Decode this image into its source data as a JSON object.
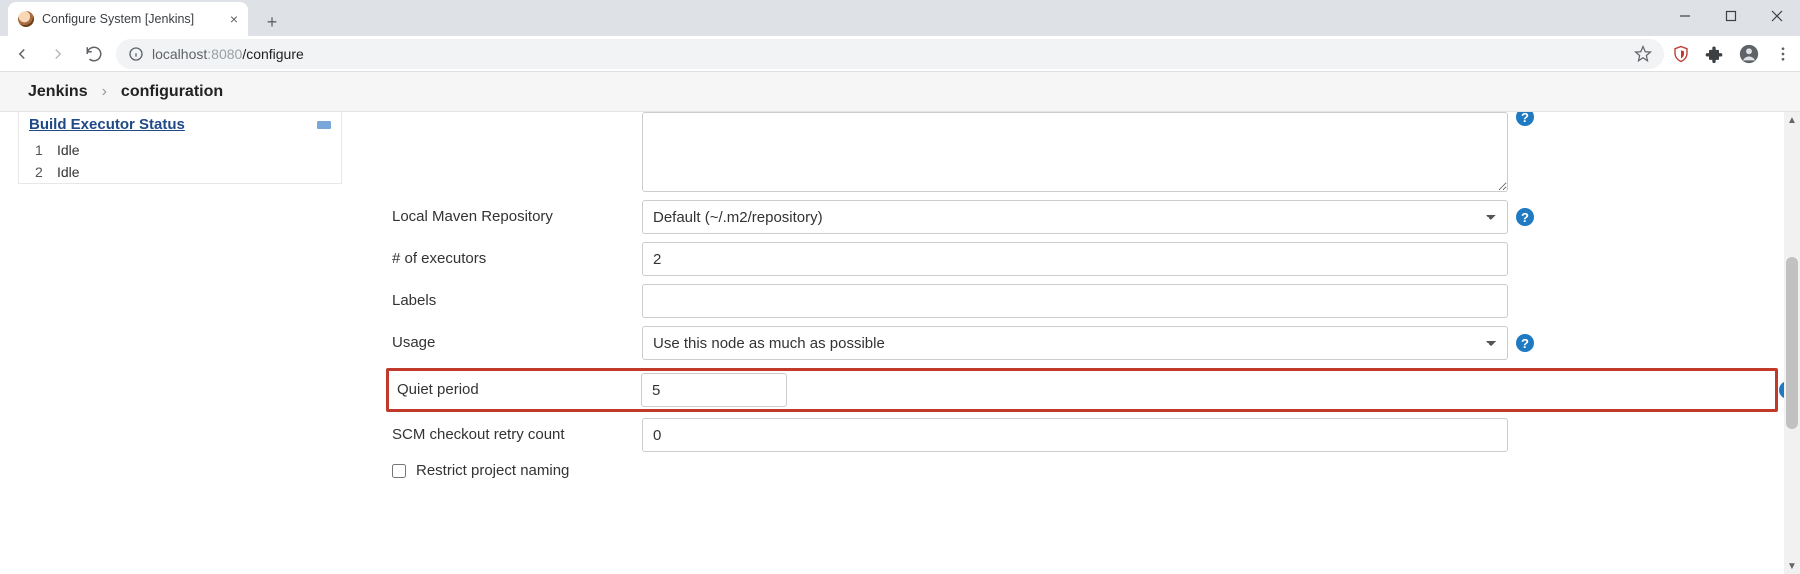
{
  "browser": {
    "tab_title": "Configure System [Jenkins]",
    "url_host": "localhost",
    "url_port": ":8080",
    "url_path": "/configure"
  },
  "breadcrumb": {
    "root": "Jenkins",
    "current": "configuration"
  },
  "sidebar": {
    "panel_title": "Build Executor Status",
    "executors": [
      {
        "num": "1",
        "state": "Idle"
      },
      {
        "num": "2",
        "state": "Idle"
      }
    ]
  },
  "form": {
    "maven_repo_label": "Local Maven Repository",
    "maven_repo_value": "Default (~/.m2/repository)",
    "executors_label": "# of executors",
    "executors_value": "2",
    "labels_label": "Labels",
    "labels_value": "",
    "usage_label": "Usage",
    "usage_value": "Use this node as much as possible",
    "quiet_label": "Quiet period",
    "quiet_value": "5",
    "scm_label": "SCM checkout retry count",
    "scm_value": "0",
    "restrict_label": "Restrict project naming",
    "restrict_checked": false
  },
  "icons": {
    "help": "?"
  }
}
